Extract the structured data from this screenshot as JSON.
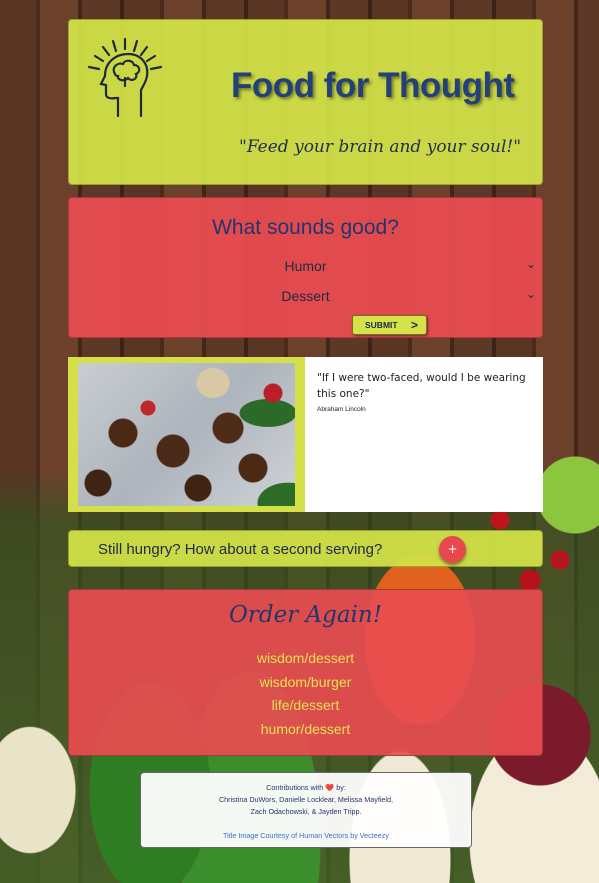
{
  "header": {
    "title": "Food for Thought",
    "tagline": "\"Feed your brain and your soul!\""
  },
  "preferences": {
    "heading": "What sounds good?",
    "select_one": "Humor",
    "select_two": "Dessert",
    "submit_label": "SUBMIT",
    "submit_arrow": ">"
  },
  "result": {
    "quote": "\"If I were two-faced, would I be wearing this one?\"",
    "author": "Abraham Lincoln"
  },
  "second_serving": {
    "text": "Still hungry? How about a second serving?",
    "button": "+"
  },
  "order_again": {
    "heading": "Order Again!",
    "items": [
      "wisdom/dessert",
      "wisdom/burger",
      "life/dessert",
      "humor/dessert"
    ]
  },
  "footer": {
    "contributions_prefix": "Contributions with",
    "heart": "❤️",
    "contributions_suffix": "by:",
    "names_line1": "Christina DuWors, Danielle Locklear, Melissa Mayfield,",
    "names_line2": "Zach Odachowski, & Jayden Tripp.",
    "credit": "Title Image Courtesy of Human Vectors by Vecteezy"
  },
  "colors": {
    "yellow_panel": "#d4e448",
    "red_panel": "#e84c50",
    "navy_text": "#23407a",
    "history_link": "#e9e150"
  }
}
